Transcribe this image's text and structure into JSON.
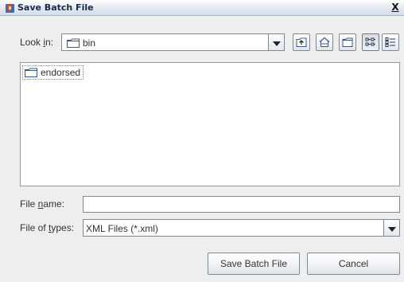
{
  "window": {
    "title": "Save Batch File",
    "close_label": "X"
  },
  "look_in": {
    "label_pre": "Look ",
    "label_mnemonic": "i",
    "label_post": "n:",
    "selected": "bin",
    "folder_icon": "folder-icon"
  },
  "toolbar": {
    "buttons": [
      {
        "name": "up-one-level-icon"
      },
      {
        "name": "home-icon"
      },
      {
        "name": "new-folder-icon"
      },
      {
        "name": "list-view-icon",
        "pressed": true
      },
      {
        "name": "details-view-icon"
      }
    ]
  },
  "file_list": {
    "items": [
      {
        "name": "endorsed",
        "type": "folder"
      }
    ]
  },
  "file_name": {
    "label_pre": "File ",
    "label_mnemonic": "n",
    "label_post": "ame:",
    "value": ""
  },
  "file_types": {
    "label_pre": "File of ",
    "label_mnemonic": "t",
    "label_post": "ypes:",
    "selected": "XML Files (*.xml)"
  },
  "buttons": {
    "save": "Save Batch File",
    "cancel": "Cancel"
  },
  "colors": {
    "background": "#eeeeee",
    "border": "#7a8a99",
    "title_text": "#1a2a48",
    "folder_stroke": "#3d5a80"
  }
}
